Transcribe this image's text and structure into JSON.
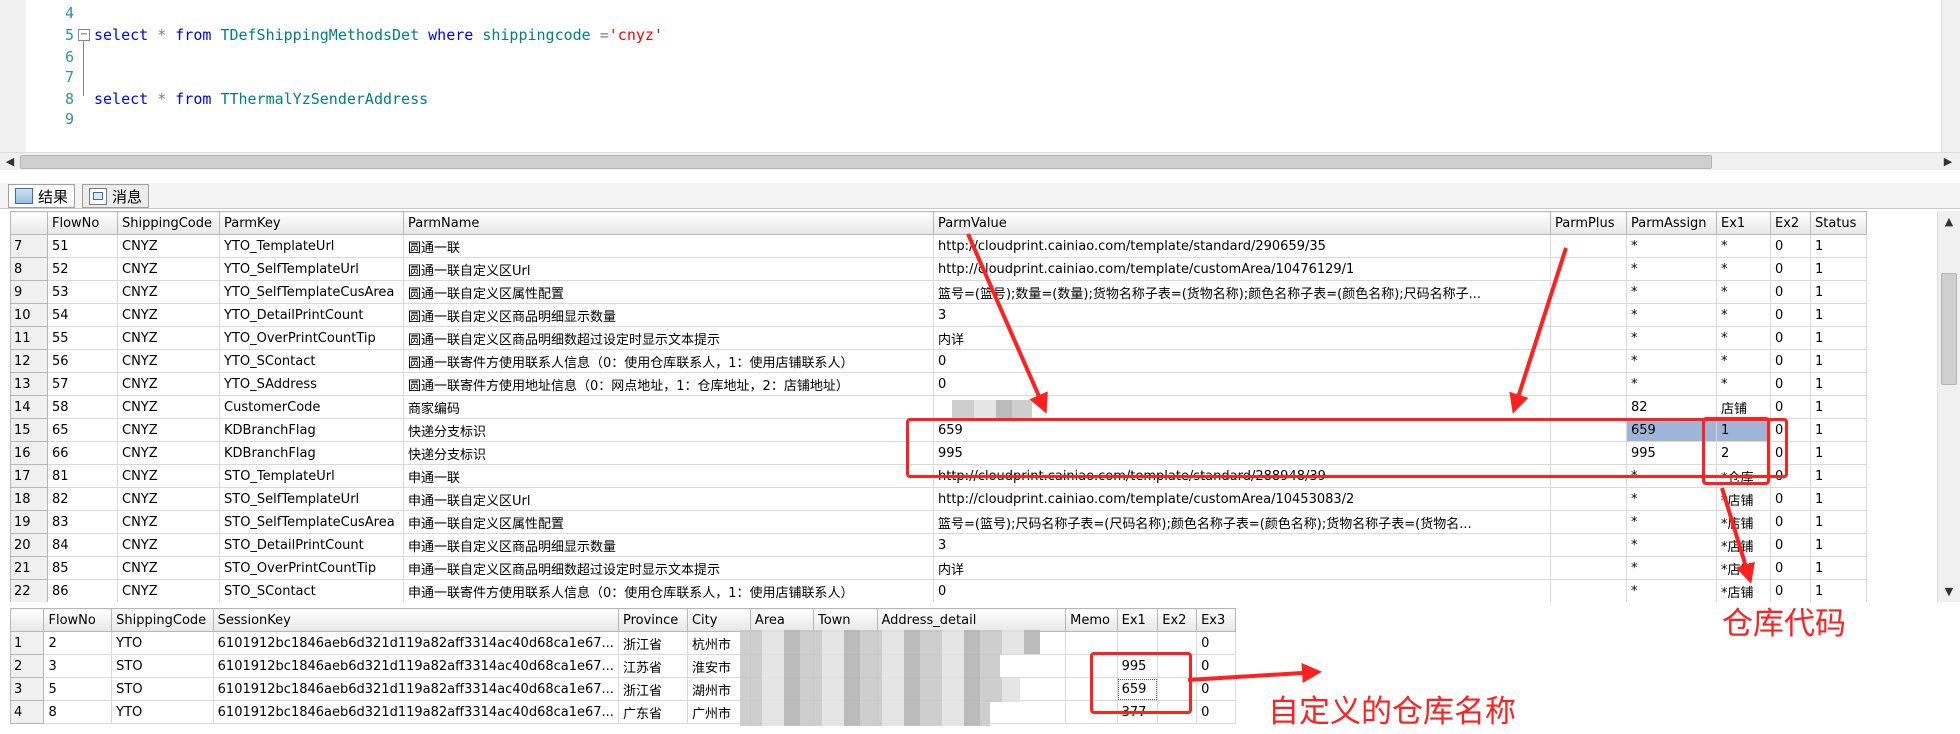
{
  "editor": {
    "lines": [
      {
        "no": "4",
        "tokens": []
      },
      {
        "no": "5",
        "tokens": [
          [
            "kw",
            "select"
          ],
          [
            "op",
            " * "
          ],
          [
            "kw",
            "from"
          ],
          [
            "txt",
            " "
          ],
          [
            "obj",
            "TDefShippingMethodsDet"
          ],
          [
            "txt",
            " "
          ],
          [
            "kw",
            "where"
          ],
          [
            "txt",
            " "
          ],
          [
            "obj",
            "shippingcode"
          ],
          [
            "op",
            " ="
          ],
          [
            "str",
            "'cnyz'"
          ]
        ]
      },
      {
        "no": "6",
        "tokens": []
      },
      {
        "no": "7",
        "tokens": []
      },
      {
        "no": "8",
        "tokens": [
          [
            "kw",
            "select"
          ],
          [
            "op",
            " * "
          ],
          [
            "kw",
            "from"
          ],
          [
            "txt",
            " "
          ],
          [
            "obj",
            "TThermalYzSenderAddress"
          ]
        ]
      },
      {
        "no": "9",
        "tokens": []
      }
    ]
  },
  "tabs": [
    {
      "label": "结果",
      "icon": "grid-icon"
    },
    {
      "label": "消息",
      "icon": "message-icon"
    }
  ],
  "grid1": {
    "columns": [
      "FlowNo",
      "ShippingCode",
      "ParmKey",
      "ParmName",
      "ParmValue",
      "ParmPlus",
      "ParmAssign",
      "Ex1",
      "Ex2",
      "Status"
    ],
    "rows": [
      [
        "7",
        "51",
        "CNYZ",
        "YTO_TemplateUrl",
        "圆通一联",
        "http://cloudprint.cainiao.com/template/standard/290659/35",
        "",
        "*",
        "*",
        "0",
        "1"
      ],
      [
        "8",
        "52",
        "CNYZ",
        "YTO_SelfTemplateUrl",
        "圆通一联自定义区Url",
        "http://cloudprint.cainiao.com/template/customArea/10476129/1",
        "",
        "*",
        "*",
        "0",
        "1"
      ],
      [
        "9",
        "53",
        "CNYZ",
        "YTO_SelfTemplateCusArea",
        "圆通一联自定义区属性配置",
        "篮号=(篮号);数量=(数量);货物名称子表=(货物名称);颜色名称子表=(颜色名称);尺码名称子...",
        "",
        "*",
        "*",
        "0",
        "1"
      ],
      [
        "10",
        "54",
        "CNYZ",
        "YTO_DetailPrintCount",
        "圆通一联自定义区商品明细显示数量",
        "3",
        "",
        "*",
        "*",
        "0",
        "1"
      ],
      [
        "11",
        "55",
        "CNYZ",
        "YTO_OverPrintCountTip",
        "圆通一联自定义区商品明细数超过设定时显示文本提示",
        "内详",
        "",
        "*",
        "*",
        "0",
        "1"
      ],
      [
        "12",
        "56",
        "CNYZ",
        "YTO_SContact",
        "圆通一联寄件方使用联系人信息（0：使用仓库联系人，1：使用店铺联系人）",
        "0",
        "",
        "*",
        "*",
        "0",
        "1"
      ],
      [
        "13",
        "57",
        "CNYZ",
        "YTO_SAddress",
        "圆通一联寄件方使用地址信息（0：网点地址，1：仓库地址，2：店铺地址）",
        "0",
        "",
        "*",
        "*",
        "0",
        "1"
      ],
      [
        "14",
        "58",
        "CNYZ",
        "CustomerCode",
        "商家编码",
        "",
        "",
        "82",
        "店铺",
        "0",
        "1"
      ],
      [
        "15",
        "65",
        "CNYZ",
        "KDBranchFlag",
        "快递分支标识",
        "659",
        "",
        "659",
        "1",
        "0",
        "1"
      ],
      [
        "16",
        "66",
        "CNYZ",
        "KDBranchFlag",
        "快递分支标识",
        "995",
        "",
        "995",
        "2",
        "0",
        "1"
      ],
      [
        "17",
        "81",
        "CNYZ",
        "STO_TemplateUrl",
        "申通一联",
        "http://cloudprint.cainiao.com/template/standard/288948/39",
        "",
        "*",
        "*仓库",
        "0",
        "1"
      ],
      [
        "18",
        "82",
        "CNYZ",
        "STO_SelfTemplateUrl",
        "申通一联自定义区Url",
        "http://cloudprint.cainiao.com/template/customArea/10453083/2",
        "",
        "*",
        "*店铺",
        "0",
        "1"
      ],
      [
        "19",
        "83",
        "CNYZ",
        "STO_SelfTemplateCusArea",
        "申通一联自定义区属性配置",
        "篮号=(篮号);尺码名称子表=(尺码名称);颜色名称子表=(颜色名称);货物名称子表=(货物名...",
        "",
        "*",
        "*店铺",
        "0",
        "1"
      ],
      [
        "20",
        "84",
        "CNYZ",
        "STO_DetailPrintCount",
        "申通一联自定义区商品明细显示数量",
        "3",
        "",
        "*",
        "*店铺",
        "0",
        "1"
      ],
      [
        "21",
        "85",
        "CNYZ",
        "STO_OverPrintCountTip",
        "申通一联自定义区商品明细数超过设定时显示文本提示",
        "内详",
        "",
        "*",
        "*店铺",
        "0",
        "1"
      ],
      [
        "22",
        "86",
        "CNYZ",
        "STO_SContact",
        "申通一联寄件方使用联系人信息（0：使用仓库联系人，1：使用店铺联系人）",
        "0",
        "",
        "*",
        "*店铺",
        "0",
        "1"
      ]
    ]
  },
  "grid2": {
    "columns": [
      "FlowNo",
      "ShippingCode",
      "SessionKey",
      "Province",
      "City",
      "Area",
      "Town",
      "Address_detail",
      "Memo",
      "Ex1",
      "Ex2",
      "Ex3"
    ],
    "rows": [
      [
        "1",
        "2",
        "YTO",
        "6101912bc1846aeb6d321d119a82aff3314ac40d68ca1e67...",
        "浙江省",
        "杭州市",
        "",
        "",
        "",
        "",
        "",
        "",
        "0"
      ],
      [
        "2",
        "3",
        "STO",
        "6101912bc1846aeb6d321d119a82aff3314ac40d68ca1e67...",
        "江苏省",
        "淮安市",
        "",
        "",
        "",
        "",
        "995",
        "",
        "0"
      ],
      [
        "3",
        "5",
        "STO",
        "6101912bc1846aeb6d321d119a82aff3314ac40d68ca1e67...",
        "浙江省",
        "湖州市",
        "",
        "",
        "",
        "",
        "659",
        "",
        "0"
      ],
      [
        "4",
        "8",
        "YTO",
        "6101912bc1846aeb6d321d119a82aff3314ac40d68ca1e67...",
        "广东省",
        "广州市",
        "",
        "",
        "",
        "",
        "377",
        "",
        "0"
      ]
    ]
  },
  "annotations": {
    "warehouse_code": "仓库代码",
    "custom_warehouse_name": "自定义的仓库名称"
  },
  "colors": {
    "annotation": "#ff2020",
    "selection": "#9fb5d8"
  }
}
